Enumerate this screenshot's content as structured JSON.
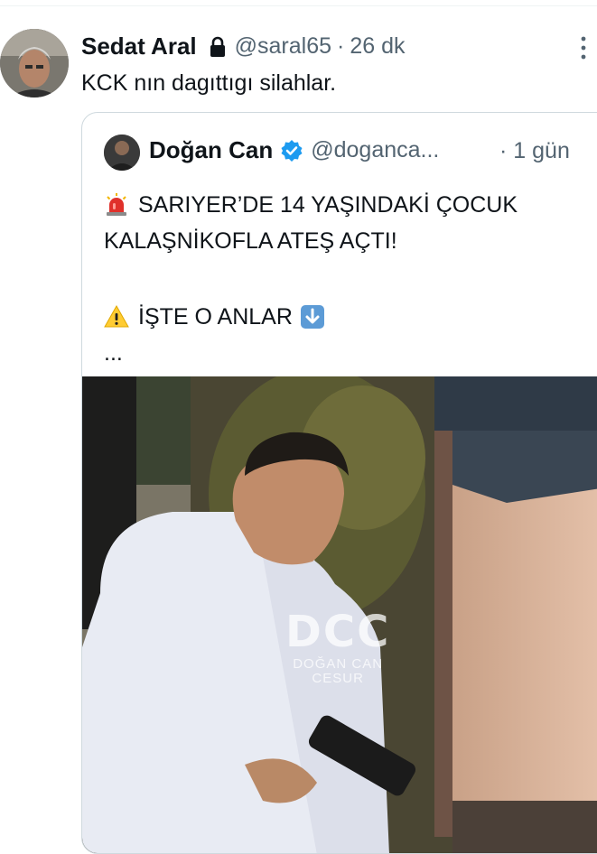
{
  "tweet": {
    "author_name": "Sedat Aral",
    "handle": "@saral65",
    "separator": "·",
    "time": "26 dk",
    "text": "KCK nın dagıttıgı silahlar.",
    "icons": [
      "lock-icon",
      "more-icon"
    ]
  },
  "quote": {
    "author_name": "Doğan Can",
    "handle": "@doganca...",
    "separator": "·",
    "time": "1 gün",
    "line1": "SARIYER’DE 14 YAŞINDAKİ ÇOCUK",
    "line2": "KALAŞNİKOFLA ATEŞ AÇTI!",
    "line3": "İŞTE O ANLAR",
    "ellipsis": "...",
    "icons": [
      "verified-icon",
      "siren-icon",
      "warning-icon",
      "down-arrow-icon"
    ],
    "media": {
      "watermark_logo": "DCC",
      "watermark_line1": "DOĞAN CAN",
      "watermark_line2": "CESUR"
    }
  },
  "colors": {
    "text": "#0f1419",
    "secondary": "#536471",
    "verified": "#1d9bf0",
    "border": "#cfd9de"
  }
}
